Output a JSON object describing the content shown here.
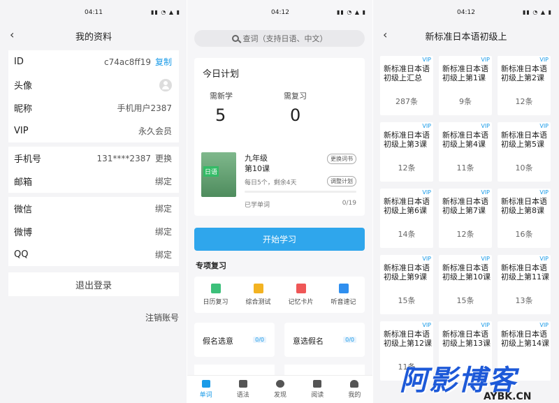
{
  "panel1": {
    "time": "04:11",
    "title": "我的资料",
    "rows1": [
      {
        "label": "ID",
        "value": "c74ac8ff19",
        "action": "复制"
      },
      {
        "label": "头像"
      },
      {
        "label": "昵称",
        "value": "手机用户2387"
      },
      {
        "label": "VIP",
        "value": "永久会员"
      }
    ],
    "rows2": [
      {
        "label": "手机号",
        "value": "131****2387",
        "action": "更换"
      },
      {
        "label": "邮箱",
        "action": "绑定"
      }
    ],
    "rows3": [
      {
        "label": "微信",
        "action": "绑定"
      },
      {
        "label": "微博",
        "action": "绑定"
      },
      {
        "label": "QQ",
        "action": "绑定"
      }
    ],
    "logout": "退出登录",
    "cancel": "注销账号"
  },
  "panel2": {
    "time": "04:12",
    "search_placeholder": "查词（支持日语、中文）",
    "plan": {
      "title": "今日计划",
      "new_label": "需新学",
      "new_value": "5",
      "review_label": "需复习",
      "review_value": "0",
      "book_badge": "日语",
      "grade": "九年级",
      "lesson": "第10课",
      "change_book": "更换词书",
      "desc": "每日5个，剩余4天",
      "adjust": "调整计划",
      "learned_label": "已学单词",
      "learned_count": "0/19",
      "progress": 0
    },
    "start": "开始学习",
    "section": "专项复习",
    "tools": [
      {
        "label": "日历复习",
        "icon": "calendar-icon",
        "color": "#3cc07a"
      },
      {
        "label": "综合测试",
        "icon": "quiz-icon",
        "color": "#f3b322"
      },
      {
        "label": "记忆卡片",
        "icon": "cards-icon",
        "color": "#ef5757"
      },
      {
        "label": "听音速记",
        "icon": "audio-icon",
        "color": "#2f8fef"
      }
    ],
    "mini": [
      {
        "title": "假名选意",
        "badge": "0/0"
      },
      {
        "title": "意选假名",
        "badge": "0/0"
      }
    ],
    "tabs": [
      {
        "label": "单词",
        "icon": "book-icon"
      },
      {
        "label": "语法",
        "icon": "grad-cap-icon"
      },
      {
        "label": "发现",
        "icon": "compass-icon"
      },
      {
        "label": "阅读",
        "icon": "tag-icon"
      },
      {
        "label": "我的",
        "icon": "person-icon"
      }
    ]
  },
  "panel3": {
    "time": "04:12",
    "title": "新标准日本语初级上",
    "vip": "VIP",
    "cells": [
      {
        "name": "新标准日本语初级上汇总",
        "count": "287条"
      },
      {
        "name": "新标准日本语初级上第1课",
        "count": "9条"
      },
      {
        "name": "新标准日本语初级上第2课",
        "count": "12条"
      },
      {
        "name": "新标准日本语初级上第3课",
        "count": "12条"
      },
      {
        "name": "新标准日本语初级上第4课",
        "count": "11条"
      },
      {
        "name": "新标准日本语初级上第5课",
        "count": "10条"
      },
      {
        "name": "新标准日本语初级上第6课",
        "count": "14条"
      },
      {
        "name": "新标准日本语初级上第7课",
        "count": "12条"
      },
      {
        "name": "新标准日本语初级上第8课",
        "count": "16条"
      },
      {
        "name": "新标准日本语初级上第9课",
        "count": "15条"
      },
      {
        "name": "新标准日本语初级上第10课",
        "count": "15条"
      },
      {
        "name": "新标准日本语初级上第11课",
        "count": "13条"
      },
      {
        "name": "新标准日本语初级上第12课",
        "count": "11条"
      },
      {
        "name": "新标准日本语初级上第13课",
        "count": ""
      },
      {
        "name": "新标准日本语初级上第14课",
        "count": ""
      }
    ]
  },
  "watermark": {
    "big": "阿影博客",
    "small": "AYBK.CN"
  }
}
